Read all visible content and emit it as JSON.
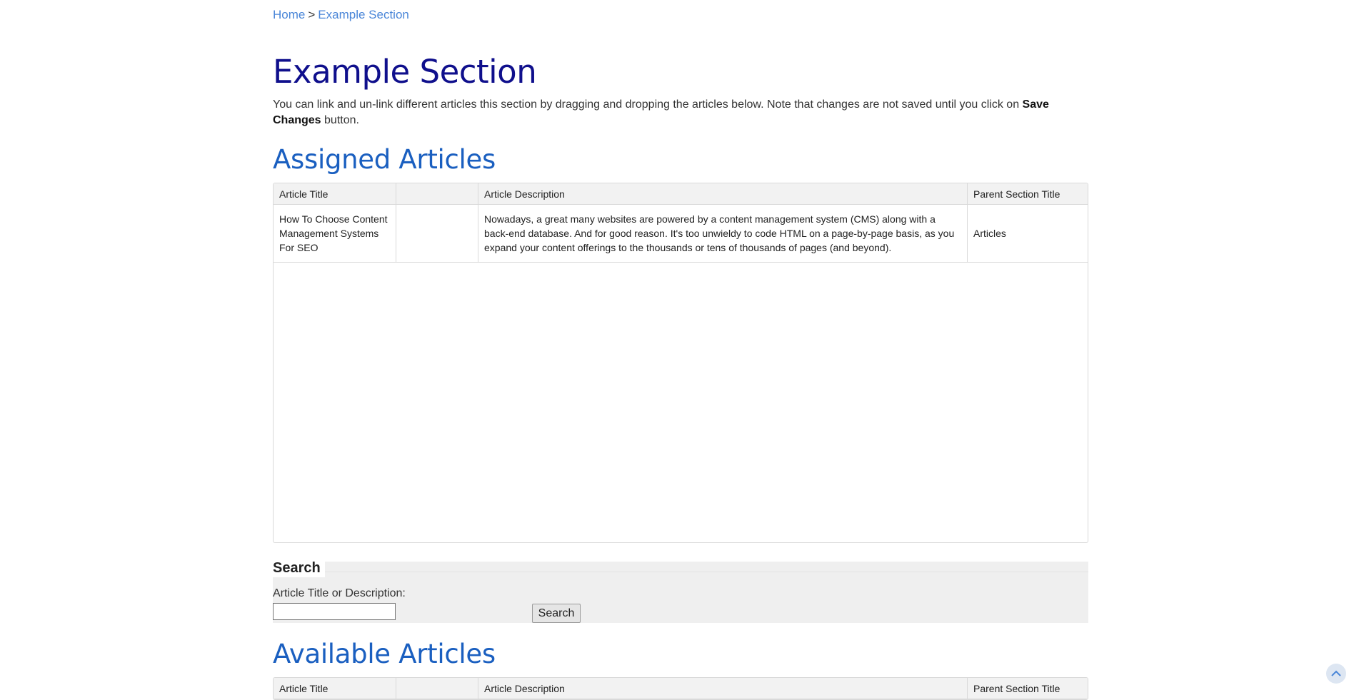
{
  "breadcrumb": {
    "home": "Home",
    "separator": ">",
    "current": "Example Section"
  },
  "page": {
    "title": "Example Section",
    "intro_text": "You can link and un-link different articles this section by dragging and dropping the articles below. Note that changes are not saved until you click on ",
    "intro_bold": "Save Changes",
    "intro_end": " button."
  },
  "assigned": {
    "heading": "Assigned Articles",
    "columns": [
      "Article Title",
      "",
      "Article Description",
      "Parent Section Title"
    ],
    "rows": [
      {
        "title": "How To Choose Content Management Systems For SEO",
        "extra": "",
        "description": "Nowadays, a great many websites are powered by a content management system (CMS) along with a back-end database. And for good reason. It's too unwieldy to code HTML on a page-by-page basis, as you expand your content offerings to the thousands or tens of thousands of pages (and beyond).",
        "parent": "Articles"
      }
    ]
  },
  "search": {
    "heading": "Search",
    "label": "Article Title or Description:",
    "input_value": "",
    "button_label": "Search"
  },
  "available": {
    "heading": "Available Articles",
    "columns": [
      "Article Title",
      "",
      "Article Description",
      "Parent Section Title"
    ]
  },
  "colors": {
    "title": "#0f0f8c",
    "heading": "#1a5fc0",
    "link": "#4a86d8"
  },
  "icons": {
    "scroll_top": "chevron-up-icon"
  }
}
